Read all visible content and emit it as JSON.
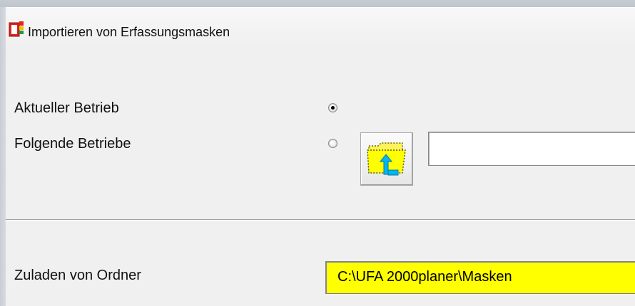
{
  "window": {
    "title": "Importieren von Erfassungsmasken",
    "icon": "app-icon"
  },
  "options": {
    "current_label": "Aktueller Betrieb",
    "current_selected": true,
    "following_label": "Folgende Betriebe",
    "following_selected": false,
    "browse_icon": "folder-upload-icon",
    "following_value": ""
  },
  "load_from": {
    "label": "Zuladen von Ordner",
    "path": "C:\\UFA 2000planer\\Masken",
    "field_color": "#ffff00"
  }
}
